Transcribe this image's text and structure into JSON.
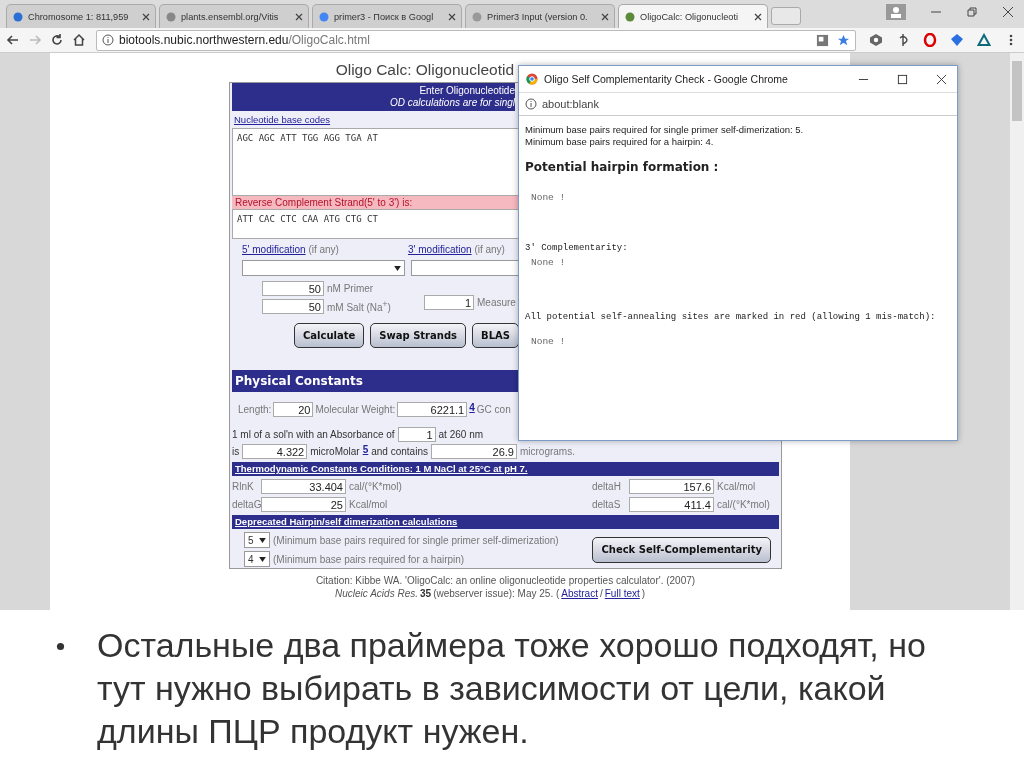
{
  "browser": {
    "tabs": [
      {
        "label": "Chromosome 1: 811,959",
        "selected": false
      },
      {
        "label": "plants.ensembl.org/Vitis",
        "selected": false
      },
      {
        "label": "primer3 - Поиск в Googl",
        "selected": false
      },
      {
        "label": "Primer3 Input (version 0.",
        "selected": false
      },
      {
        "label": "OligoCalc: Oligonucleoti",
        "selected": true
      }
    ],
    "url_host": "biotools.nubic.northwestern.edu",
    "url_path": "/OligoCalc.html"
  },
  "page": {
    "title": "Oligo Calc: Oligonucleotid",
    "header_lines": [
      "Enter Oligonucleotide",
      "OD calculations are for singl"
    ],
    "base_codes_link": "Nucleotide base codes",
    "sequence": "AGC AGC ATT TGG AGG TGA AT",
    "reverse_label": "Reverse Complement Strand(5' to 3') is:",
    "reverse_sequence": "ATT CAC CTC CAA ATG CTG CT",
    "mod5": {
      "link": "5' modification",
      "note": "(if any)"
    },
    "mod3": {
      "link": "3' modification",
      "note": "(if any)"
    },
    "primer": {
      "value": "50",
      "label": "nM Primer"
    },
    "salt": {
      "value": "50",
      "label": "mM Salt (Na$^{+}$)"
    },
    "measured": {
      "value": "1",
      "label": "Measure"
    },
    "buttons": [
      "Calculate",
      "Swap Strands",
      "BLAS"
    ],
    "physical_title": "Physical Constants",
    "length": {
      "label": "Length:",
      "value": "20"
    },
    "mw": {
      "label": "Molecular Weight:",
      "value": "6221.1",
      "footnote": "4",
      "next": "GC con"
    },
    "absorbance": {
      "label": "1 ml of a sol'n with an Absorbance of",
      "value": "1",
      "unit": "at 260 nm"
    },
    "conc": {
      "is": "is",
      "value": "4.322",
      "unit": "microMolar",
      "footnote": "5",
      "contains": "and contains",
      "mass": "26.9",
      "mass_unit": "micrograms."
    },
    "thermo_title": "Thermodynamic Constants Conditions: 1 M NaCl at 25°C at pH 7.",
    "thermo": [
      {
        "label": "RlnK",
        "value": "33.404",
        "unit": "cal/(°K*mol)"
      },
      {
        "label": "deltaH",
        "value": "157.6",
        "unit": "Kcal/mol"
      },
      {
        "label": "deltaG",
        "value": "25",
        "unit": "Kcal/mol"
      },
      {
        "label": "deltaS",
        "value": "411.4",
        "unit": "cal/(°K*mol)"
      }
    ],
    "deprecated_title": "Deprecated Hairpin/self dimerization calculations",
    "min_pairs": [
      {
        "value": "5",
        "label": "(Minimum base pairs required for single primer self-dimerization)"
      },
      {
        "value": "4",
        "label": "(Minimum base pairs required for a hairpin)"
      }
    ],
    "check_button": "Check Self-Complementarity",
    "citation": [
      "Citation: Kibbe WA. 'OligoCalc: an online oligonucleotide properties calculator'. (2007)"
    ],
    "citation2": {
      "journal": "Nucleic Acids Res.",
      "volume": "35",
      "rest": "(webserver issue): May 25. (",
      "abstract": "Abstract",
      "sep": "/",
      "full": "Full text",
      "end": ")"
    }
  },
  "popup": {
    "title": "Oligo Self Complementarity Check - Google Chrome",
    "url": "about:blank",
    "info_lines": [
      "Minimum base pairs required for single primer self-dimerization: 5.",
      "Minimum base pairs required for a hairpin: 4."
    ],
    "heading": "Potential hairpin formation :",
    "none_1": "None !",
    "comp_label": "3' Complementarity:",
    "none_2": "None !",
    "annealing_label": "All potential self-annealing sites are marked in red (allowing 1 mis-match):",
    "none_3": "None !"
  },
  "slide_text": "Остальные два праймера тоже хорошо подходят, но тут нужно выбирать в зависимости от цели, какой длины ПЦР продукт нужен."
}
